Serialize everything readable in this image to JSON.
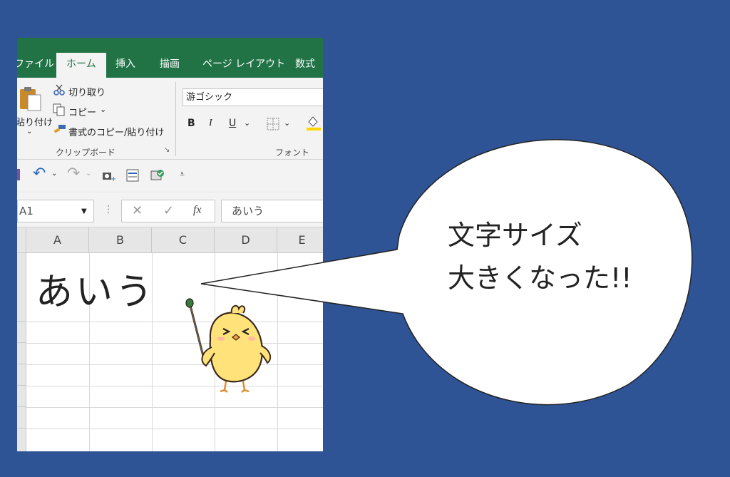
{
  "tabs": {
    "file": "ファイル",
    "home": "ホーム",
    "insert": "挿入",
    "draw": "描画",
    "page_layout": "ページ レイアウト",
    "formulas": "数式"
  },
  "clipboard": {
    "paste": "貼り付け",
    "cut": "切り取り",
    "copy": "コピー",
    "format_painter": "書式のコピー/貼り付け",
    "group_label": "クリップボード"
  },
  "font": {
    "font_name": "游ゴシック",
    "bold": "B",
    "italic": "I",
    "underline": "U",
    "group_label": "フォント"
  },
  "formula_bar": {
    "name_box": "A1",
    "fx": "fx",
    "value": "あいう"
  },
  "grid": {
    "columns": [
      "A",
      "B",
      "C",
      "D",
      "E"
    ],
    "cell_a1": "あいう"
  },
  "bubble": {
    "line1": "文字サイズ",
    "line2": "大きくなった!!"
  },
  "colors": {
    "background": "#2f5496",
    "excel_green": "#217346"
  }
}
